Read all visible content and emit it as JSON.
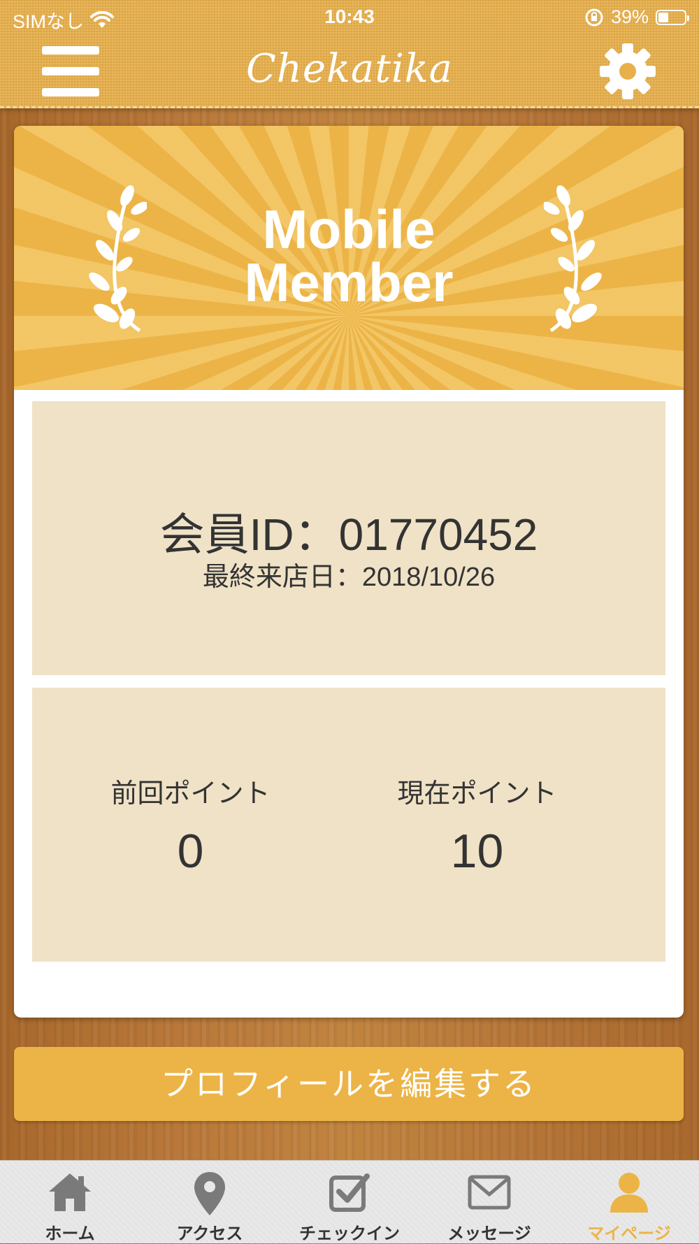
{
  "status_bar": {
    "carrier": "SIMなし",
    "time": "10:43",
    "battery": "39%",
    "battery_level": 0.39
  },
  "header": {
    "app_title": "Chekatika",
    "menu_icon": "hamburger-menu-icon",
    "settings_icon": "gear-icon"
  },
  "banner": {
    "line1": "Mobile",
    "line2": "Member"
  },
  "member": {
    "id_text": "会員ID：01770452",
    "last_visit_text": "最終来店日：2018/10/26"
  },
  "points": {
    "previous_label": "前回ポイント",
    "previous_value": "0",
    "current_label": "現在ポイント",
    "current_value": "10"
  },
  "actions": {
    "edit_profile": "プロフィールを編集する"
  },
  "tabs": [
    {
      "label": "ホーム",
      "icon": "home-icon",
      "active": false
    },
    {
      "label": "アクセス",
      "icon": "map-pin-icon",
      "active": false
    },
    {
      "label": "チェックイン",
      "icon": "checkbox-icon",
      "active": false
    },
    {
      "label": "メッセージ",
      "icon": "envelope-icon",
      "active": false
    },
    {
      "label": "マイページ",
      "icon": "person-icon",
      "active": true
    }
  ],
  "colors": {
    "accent": "#ecb446",
    "panel": "#efe2c6",
    "tab_inactive": "#7a7a7a"
  }
}
